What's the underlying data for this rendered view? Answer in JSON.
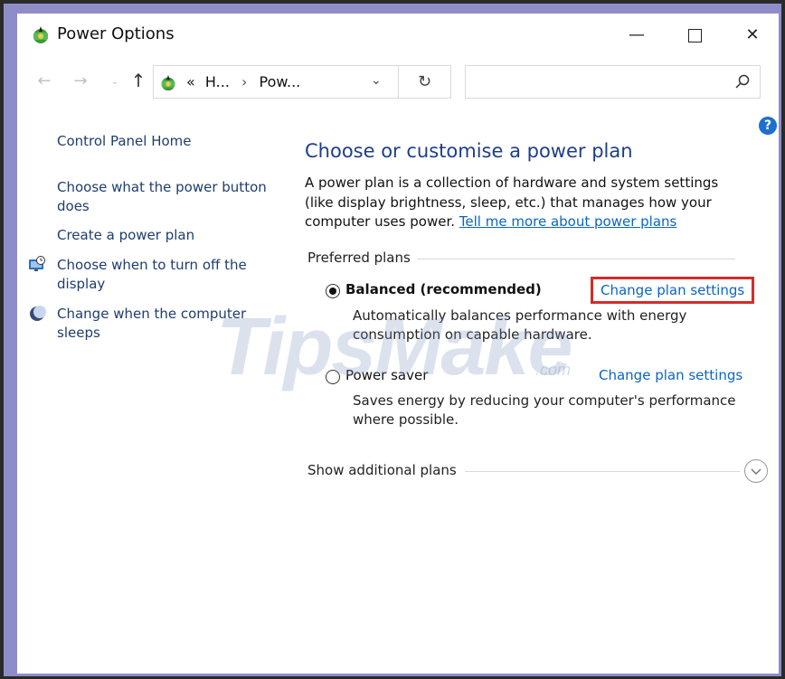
{
  "window": {
    "title": "Power Options",
    "minimize_label": "—",
    "close_label": "✕"
  },
  "nav": {
    "back_glyph": "←",
    "forward_glyph": "→",
    "recent_glyph": "⌄",
    "up_glyph": "↑",
    "breadcrumb": [
      "«",
      "H...",
      "›",
      "Pow..."
    ],
    "dropdown_glyph": "⌄",
    "refresh_glyph": "↻",
    "search_placeholder": ""
  },
  "help_glyph": "?",
  "sidebar": {
    "home": "Control Panel Home",
    "items": [
      {
        "label": "Choose what the power button does"
      },
      {
        "label": "Create a power plan"
      },
      {
        "label": "Choose when to turn off the display",
        "icon": "display-clock-icon"
      },
      {
        "label": "Change when the computer sleeps",
        "icon": "moon-icon"
      }
    ]
  },
  "main": {
    "heading": "Choose or customise a power plan",
    "description": "A power plan is a collection of hardware and system settings (like display brightness, sleep, etc.) that manages how your computer uses power.",
    "learn_more": "Tell me more about power plans",
    "group_label": "Preferred plans",
    "plans": [
      {
        "name": "Balanced (recommended)",
        "selected": true,
        "description": "Automatically balances performance with energy consumption on capable hardware.",
        "link": "Change plan settings"
      },
      {
        "name": "Power saver",
        "selected": false,
        "description": "Saves energy by reducing your computer's performance where possible.",
        "link": "Change plan settings"
      }
    ],
    "show_more": "Show additional plans"
  },
  "watermark": {
    "text": "TipsMake",
    "suffix": ".com"
  },
  "colors": {
    "link": "#0a66c2",
    "heading": "#1e3e8a",
    "highlight_box": "#d62b2b",
    "border_bg": "#8f8dc8"
  }
}
